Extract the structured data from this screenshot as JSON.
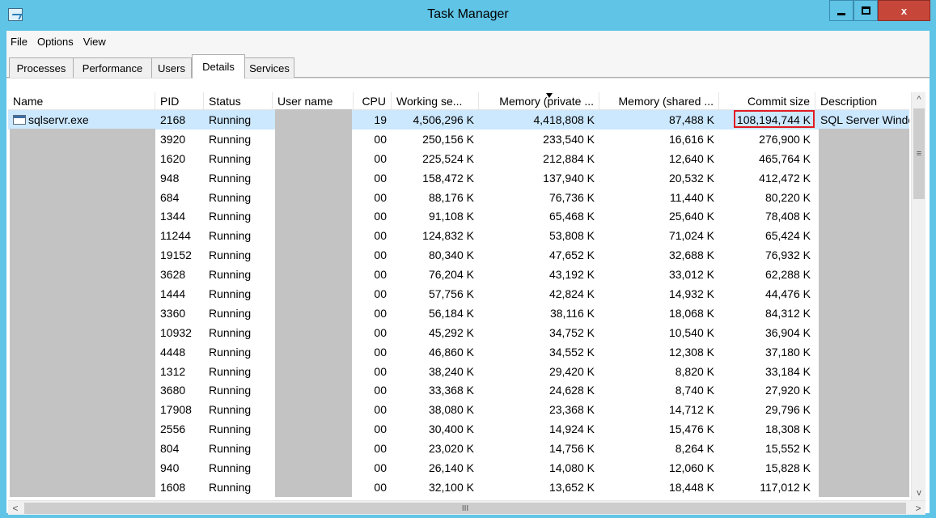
{
  "window": {
    "title": "Task Manager",
    "close_label": "x"
  },
  "menu": [
    "File",
    "Options",
    "View"
  ],
  "tabs": [
    "Processes",
    "Performance",
    "Users",
    "Details",
    "Services"
  ],
  "active_tab": "Details",
  "columns": {
    "name": "Name",
    "pid": "PID",
    "status": "Status",
    "user": "User name",
    "cpu": "CPU",
    "working_set": "Working se...",
    "mem_private": "Memory (private ...",
    "mem_shared": "Memory (shared ...",
    "commit": "Commit size",
    "description": "Description"
  },
  "sorted_column": "mem_private",
  "rows": [
    {
      "name": "sqlservr.exe",
      "pid": "2168",
      "status": "Running",
      "cpu": "19",
      "ws": "4,506,296 K",
      "mp": "4,418,808 K",
      "ms": "87,488 K",
      "cs": "108,194,744 K",
      "desc": "SQL Server Windo"
    },
    {
      "name": "",
      "pid": "3920",
      "status": "Running",
      "cpu": "00",
      "ws": "250,156 K",
      "mp": "233,540 K",
      "ms": "16,616 K",
      "cs": "276,900 K",
      "desc": ""
    },
    {
      "name": "",
      "pid": "1620",
      "status": "Running",
      "cpu": "00",
      "ws": "225,524 K",
      "mp": "212,884 K",
      "ms": "12,640 K",
      "cs": "465,764 K",
      "desc": ""
    },
    {
      "name": "",
      "pid": "948",
      "status": "Running",
      "cpu": "00",
      "ws": "158,472 K",
      "mp": "137,940 K",
      "ms": "20,532 K",
      "cs": "412,472 K",
      "desc": ""
    },
    {
      "name": "",
      "pid": "684",
      "status": "Running",
      "cpu": "00",
      "ws": "88,176 K",
      "mp": "76,736 K",
      "ms": "11,440 K",
      "cs": "80,220 K",
      "desc": ""
    },
    {
      "name": "",
      "pid": "1344",
      "status": "Running",
      "cpu": "00",
      "ws": "91,108 K",
      "mp": "65,468 K",
      "ms": "25,640 K",
      "cs": "78,408 K",
      "desc": ""
    },
    {
      "name": "",
      "pid": "11244",
      "status": "Running",
      "cpu": "00",
      "ws": "124,832 K",
      "mp": "53,808 K",
      "ms": "71,024 K",
      "cs": "65,424 K",
      "desc": ""
    },
    {
      "name": "",
      "pid": "19152",
      "status": "Running",
      "cpu": "00",
      "ws": "80,340 K",
      "mp": "47,652 K",
      "ms": "32,688 K",
      "cs": "76,932 K",
      "desc": ""
    },
    {
      "name": "",
      "pid": "3628",
      "status": "Running",
      "cpu": "00",
      "ws": "76,204 K",
      "mp": "43,192 K",
      "ms": "33,012 K",
      "cs": "62,288 K",
      "desc": ""
    },
    {
      "name": "",
      "pid": "1444",
      "status": "Running",
      "cpu": "00",
      "ws": "57,756 K",
      "mp": "42,824 K",
      "ms": "14,932 K",
      "cs": "44,476 K",
      "desc": ""
    },
    {
      "name": "",
      "pid": "3360",
      "status": "Running",
      "cpu": "00",
      "ws": "56,184 K",
      "mp": "38,116 K",
      "ms": "18,068 K",
      "cs": "84,312 K",
      "desc": ""
    },
    {
      "name": "",
      "pid": "10932",
      "status": "Running",
      "cpu": "00",
      "ws": "45,292 K",
      "mp": "34,752 K",
      "ms": "10,540 K",
      "cs": "36,904 K",
      "desc": ""
    },
    {
      "name": "",
      "pid": "4448",
      "status": "Running",
      "cpu": "00",
      "ws": "46,860 K",
      "mp": "34,552 K",
      "ms": "12,308 K",
      "cs": "37,180 K",
      "desc": ""
    },
    {
      "name": "",
      "pid": "1312",
      "status": "Running",
      "cpu": "00",
      "ws": "38,240 K",
      "mp": "29,420 K",
      "ms": "8,820 K",
      "cs": "33,184 K",
      "desc": ""
    },
    {
      "name": "",
      "pid": "3680",
      "status": "Running",
      "cpu": "00",
      "ws": "33,368 K",
      "mp": "24,628 K",
      "ms": "8,740 K",
      "cs": "27,920 K",
      "desc": ""
    },
    {
      "name": "",
      "pid": "17908",
      "status": "Running",
      "cpu": "00",
      "ws": "38,080 K",
      "mp": "23,368 K",
      "ms": "14,712 K",
      "cs": "29,796 K",
      "desc": ""
    },
    {
      "name": "",
      "pid": "2556",
      "status": "Running",
      "cpu": "00",
      "ws": "30,400 K",
      "mp": "14,924 K",
      "ms": "15,476 K",
      "cs": "18,308 K",
      "desc": ""
    },
    {
      "name": "",
      "pid": "804",
      "status": "Running",
      "cpu": "00",
      "ws": "23,020 K",
      "mp": "14,756 K",
      "ms": "8,264 K",
      "cs": "15,552 K",
      "desc": ""
    },
    {
      "name": "",
      "pid": "940",
      "status": "Running",
      "cpu": "00",
      "ws": "26,140 K",
      "mp": "14,080 K",
      "ms": "12,060 K",
      "cs": "15,828 K",
      "desc": ""
    },
    {
      "name": "",
      "pid": "1608",
      "status": "Running",
      "cpu": "00",
      "ws": "32,100 K",
      "mp": "13,652 K",
      "ms": "18,448 K",
      "cs": "117,012 K",
      "desc": ""
    }
  ],
  "highlight": {
    "row": 0,
    "column": "commit",
    "color": "#e21b22"
  },
  "colors": {
    "titlebar": "#5fc4e6",
    "selected_row": "#cce8ff",
    "redaction": "#c3c3c3",
    "close_button": "#c7463a"
  },
  "icons": {
    "app": "task-manager-icon",
    "process": "process-window-icon"
  }
}
